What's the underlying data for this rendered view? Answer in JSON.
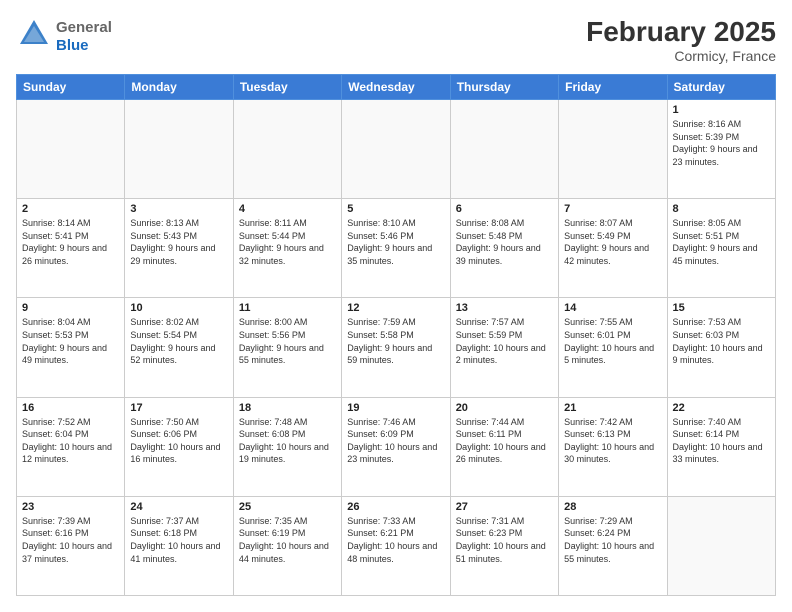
{
  "header": {
    "logo": {
      "general": "General",
      "blue": "Blue"
    },
    "title": "February 2025",
    "location": "Cormicy, France"
  },
  "weekdays": [
    "Sunday",
    "Monday",
    "Tuesday",
    "Wednesday",
    "Thursday",
    "Friday",
    "Saturday"
  ],
  "weeks": [
    [
      {
        "day": null,
        "info": ""
      },
      {
        "day": null,
        "info": ""
      },
      {
        "day": null,
        "info": ""
      },
      {
        "day": null,
        "info": ""
      },
      {
        "day": null,
        "info": ""
      },
      {
        "day": null,
        "info": ""
      },
      {
        "day": "1",
        "info": "Sunrise: 8:16 AM\nSunset: 5:39 PM\nDaylight: 9 hours and 23 minutes."
      }
    ],
    [
      {
        "day": "2",
        "info": "Sunrise: 8:14 AM\nSunset: 5:41 PM\nDaylight: 9 hours and 26 minutes."
      },
      {
        "day": "3",
        "info": "Sunrise: 8:13 AM\nSunset: 5:43 PM\nDaylight: 9 hours and 29 minutes."
      },
      {
        "day": "4",
        "info": "Sunrise: 8:11 AM\nSunset: 5:44 PM\nDaylight: 9 hours and 32 minutes."
      },
      {
        "day": "5",
        "info": "Sunrise: 8:10 AM\nSunset: 5:46 PM\nDaylight: 9 hours and 35 minutes."
      },
      {
        "day": "6",
        "info": "Sunrise: 8:08 AM\nSunset: 5:48 PM\nDaylight: 9 hours and 39 minutes."
      },
      {
        "day": "7",
        "info": "Sunrise: 8:07 AM\nSunset: 5:49 PM\nDaylight: 9 hours and 42 minutes."
      },
      {
        "day": "8",
        "info": "Sunrise: 8:05 AM\nSunset: 5:51 PM\nDaylight: 9 hours and 45 minutes."
      }
    ],
    [
      {
        "day": "9",
        "info": "Sunrise: 8:04 AM\nSunset: 5:53 PM\nDaylight: 9 hours and 49 minutes."
      },
      {
        "day": "10",
        "info": "Sunrise: 8:02 AM\nSunset: 5:54 PM\nDaylight: 9 hours and 52 minutes."
      },
      {
        "day": "11",
        "info": "Sunrise: 8:00 AM\nSunset: 5:56 PM\nDaylight: 9 hours and 55 minutes."
      },
      {
        "day": "12",
        "info": "Sunrise: 7:59 AM\nSunset: 5:58 PM\nDaylight: 9 hours and 59 minutes."
      },
      {
        "day": "13",
        "info": "Sunrise: 7:57 AM\nSunset: 5:59 PM\nDaylight: 10 hours and 2 minutes."
      },
      {
        "day": "14",
        "info": "Sunrise: 7:55 AM\nSunset: 6:01 PM\nDaylight: 10 hours and 5 minutes."
      },
      {
        "day": "15",
        "info": "Sunrise: 7:53 AM\nSunset: 6:03 PM\nDaylight: 10 hours and 9 minutes."
      }
    ],
    [
      {
        "day": "16",
        "info": "Sunrise: 7:52 AM\nSunset: 6:04 PM\nDaylight: 10 hours and 12 minutes."
      },
      {
        "day": "17",
        "info": "Sunrise: 7:50 AM\nSunset: 6:06 PM\nDaylight: 10 hours and 16 minutes."
      },
      {
        "day": "18",
        "info": "Sunrise: 7:48 AM\nSunset: 6:08 PM\nDaylight: 10 hours and 19 minutes."
      },
      {
        "day": "19",
        "info": "Sunrise: 7:46 AM\nSunset: 6:09 PM\nDaylight: 10 hours and 23 minutes."
      },
      {
        "day": "20",
        "info": "Sunrise: 7:44 AM\nSunset: 6:11 PM\nDaylight: 10 hours and 26 minutes."
      },
      {
        "day": "21",
        "info": "Sunrise: 7:42 AM\nSunset: 6:13 PM\nDaylight: 10 hours and 30 minutes."
      },
      {
        "day": "22",
        "info": "Sunrise: 7:40 AM\nSunset: 6:14 PM\nDaylight: 10 hours and 33 minutes."
      }
    ],
    [
      {
        "day": "23",
        "info": "Sunrise: 7:39 AM\nSunset: 6:16 PM\nDaylight: 10 hours and 37 minutes."
      },
      {
        "day": "24",
        "info": "Sunrise: 7:37 AM\nSunset: 6:18 PM\nDaylight: 10 hours and 41 minutes."
      },
      {
        "day": "25",
        "info": "Sunrise: 7:35 AM\nSunset: 6:19 PM\nDaylight: 10 hours and 44 minutes."
      },
      {
        "day": "26",
        "info": "Sunrise: 7:33 AM\nSunset: 6:21 PM\nDaylight: 10 hours and 48 minutes."
      },
      {
        "day": "27",
        "info": "Sunrise: 7:31 AM\nSunset: 6:23 PM\nDaylight: 10 hours and 51 minutes."
      },
      {
        "day": "28",
        "info": "Sunrise: 7:29 AM\nSunset: 6:24 PM\nDaylight: 10 hours and 55 minutes."
      },
      {
        "day": null,
        "info": ""
      }
    ]
  ]
}
